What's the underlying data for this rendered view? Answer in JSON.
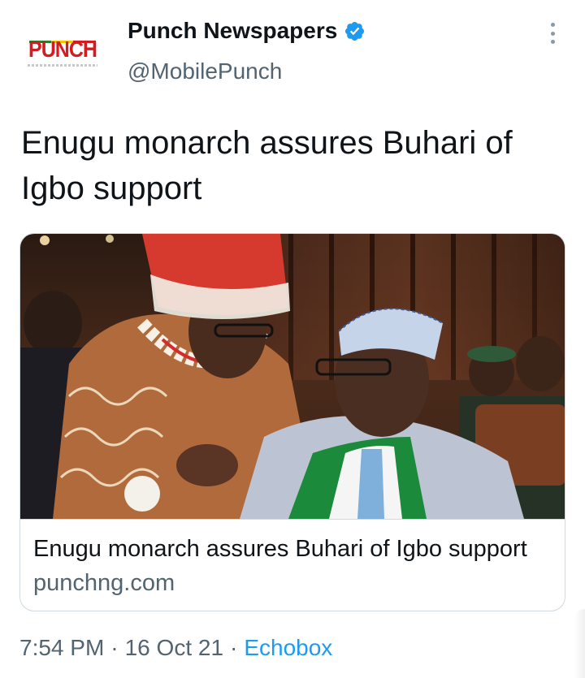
{
  "author": {
    "display_name": "Punch Newspapers",
    "handle": "@MobilePunch",
    "verified_icon": "verified-badge-icon",
    "avatar_logo": "PUNCH",
    "verified_color": "#1d9bf0"
  },
  "menu": {
    "icon": "more-vertical-icon"
  },
  "tweet": {
    "text": "Enugu monarch assures Buhari of Igbo support"
  },
  "card": {
    "title": "Enugu monarch assures Buhari of Igbo support",
    "domain": "punchng.com",
    "image_alt": "news-photo"
  },
  "footer": {
    "time": "7:54 PM",
    "separator_1": "·",
    "date": "16 Oct 21",
    "separator_2": "·",
    "source": "Echobox",
    "source_color": "#1d9bf0"
  }
}
